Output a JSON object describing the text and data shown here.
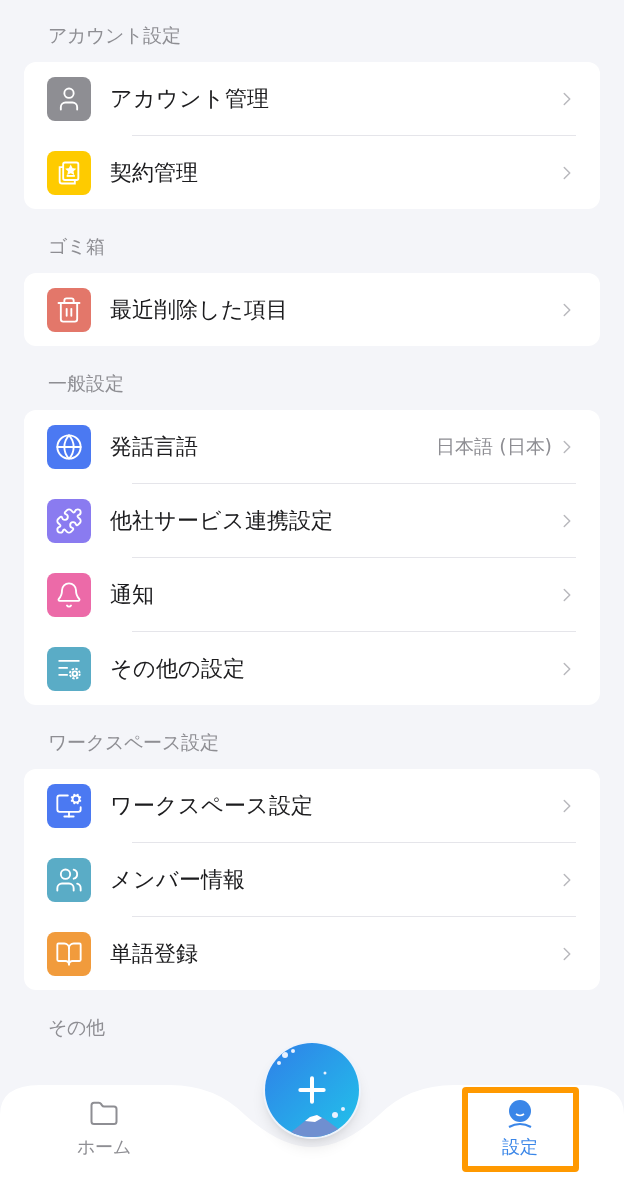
{
  "sections": [
    {
      "title": "アカウント設定",
      "items": [
        {
          "label": "アカウント管理",
          "color": "#8e8e93"
        },
        {
          "label": "契約管理",
          "color": "#fecb00"
        }
      ]
    },
    {
      "title": "ゴミ箱",
      "items": [
        {
          "label": "最近削除した項目",
          "color": "#e3776a"
        }
      ]
    },
    {
      "title": "一般設定",
      "items": [
        {
          "label": "発話言語",
          "value": "日本語 (日本)",
          "color": "#4b79f2"
        },
        {
          "label": "他社サービス連携設定",
          "color": "#8a7bf0"
        },
        {
          "label": "通知",
          "color": "#ec6aa8"
        },
        {
          "label": "その他の設定",
          "color": "#5aacc6"
        }
      ]
    },
    {
      "title": "ワークスペース設定",
      "items": [
        {
          "label": "ワークスペース設定",
          "color": "#4b79f2"
        },
        {
          "label": "メンバー情報",
          "color": "#5aacc6"
        },
        {
          "label": "単語登録",
          "color": "#f19b3c"
        }
      ]
    },
    {
      "title": "その他"
    }
  ],
  "tab_bar": {
    "tabs": [
      {
        "label": "ホーム",
        "selected": false
      },
      {
        "label": "設定",
        "selected": true
      }
    ]
  }
}
